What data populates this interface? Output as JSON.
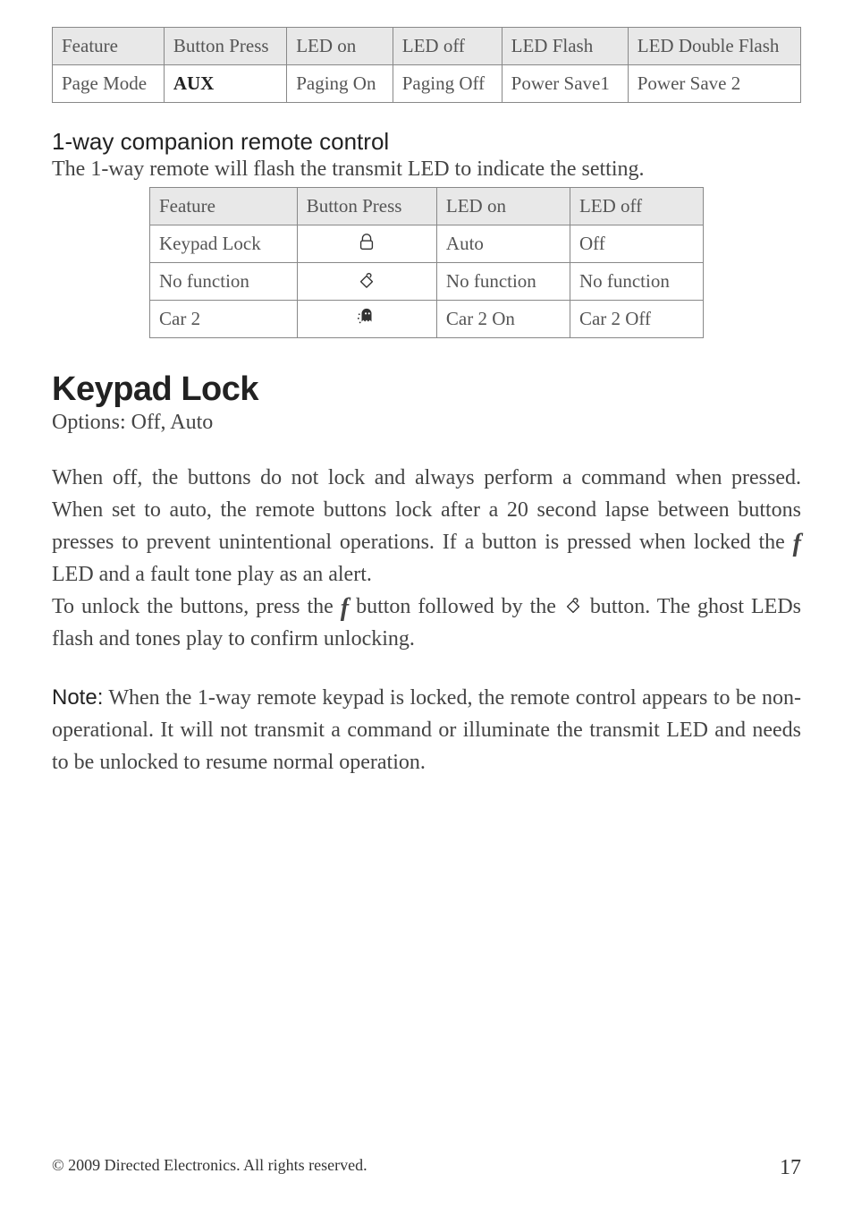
{
  "table1": {
    "headers": [
      "Feature",
      "Button Press",
      "LED on",
      "LED off",
      "LED Flash",
      "LED Double Flash"
    ],
    "row": {
      "feature": "Page Mode",
      "button": "AUX",
      "led_on": "Paging On",
      "led_off": "Paging Off",
      "led_flash": "Power Save1",
      "led_double": "Power Save 2"
    }
  },
  "section_sub": "1-way companion remote control",
  "intro": "The 1-way remote will flash the transmit LED to indicate the setting.",
  "table2": {
    "headers": [
      "Feature",
      "Button Press",
      "LED on",
      "LED off"
    ],
    "rows": [
      {
        "feature": "Keypad Lock",
        "icon": "lock",
        "led_on": "Auto",
        "led_off": "Off"
      },
      {
        "feature": "No function",
        "icon": "diamond",
        "led_on": "No function",
        "led_off": "No function"
      },
      {
        "feature": "Car 2",
        "icon": "ghost",
        "led_on": "Car 2 On",
        "led_off": "Car 2 Off"
      }
    ]
  },
  "keypad_heading": "Keypad Lock",
  "keypad_options": "Options: Off, Auto",
  "para1_a": "When off, the buttons do not lock and always perform a command when pressed. When set to auto, the remote buttons lock after a 20 second lapse between buttons presses to prevent unintentional operations. If a button is pressed when locked the ",
  "para1_b": " LED and a fault tone play as an alert.",
  "para2_a": "To unlock the buttons, press the ",
  "para2_b": " button followed by the ",
  "para2_c": " button. The ghost LEDs flash and tones play to confirm unlocking.",
  "note_label": "Note:",
  "note_body": " When the 1-way remote keypad is locked, the remote control appears to be non-operational. It will not transmit a command or illuminate the transmit LED and needs to be unlocked to resume normal operation.",
  "footer_left": "© 2009 Directed Electronics. All rights reserved.",
  "footer_right": "17"
}
